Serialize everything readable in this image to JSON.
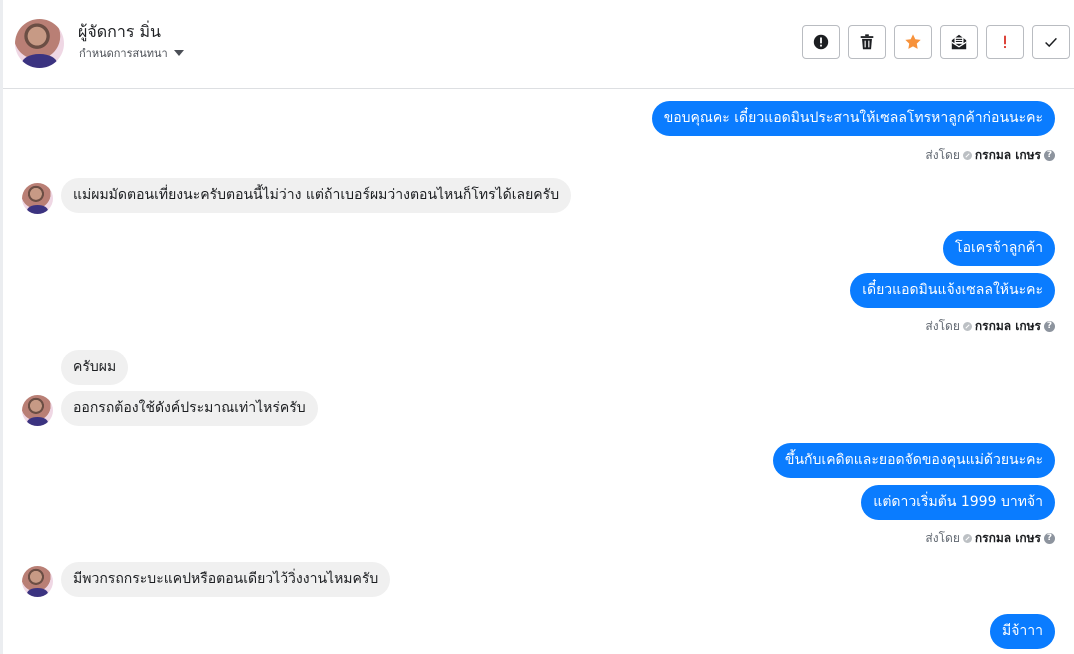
{
  "header": {
    "name": "ผู้จัดการ มิ่น",
    "subtitle": "กำหนดการสนทนา"
  },
  "toolbar": {
    "buttons": [
      {
        "icon": "alert-circle-icon"
      },
      {
        "icon": "trash-icon"
      },
      {
        "icon": "star-icon",
        "color": "#f7923b"
      },
      {
        "icon": "mail-open-icon"
      },
      {
        "icon": "exclamation-icon",
        "color": "#d93025"
      },
      {
        "icon": "check-icon"
      }
    ]
  },
  "meta": {
    "sent_by_label": "ส่งโดย",
    "sender": "กรกมล เกษร",
    "help": "?"
  },
  "messages": [
    {
      "dir": "out",
      "text": "ขอบคุณคะ เดี๋ยวแอดมินประสานให้เซลลโทรหาลูกค้าก่อนนะคะ"
    },
    {
      "dir": "in",
      "text": "แม่ผมมัดตอนเที่ยงนะครับตอนนี้ไม่ว่าง  แต่ถ้าเบอร์ผมว่างตอนไหนก็โทรได้เลยครับ"
    },
    {
      "dir": "out",
      "text": "โอเครจ้าลูกค้า"
    },
    {
      "dir": "out",
      "text": "เดี๋ยวแอดมินแจ้งเซลลให้นะคะ"
    },
    {
      "dir": "in",
      "text": "ครับผม"
    },
    {
      "dir": "in",
      "text": "ออกรถต้องใช้ดังค์ประมาณเท่าไหร่ครับ"
    },
    {
      "dir": "out",
      "text": "ขึ้นกับเคดิตและยอดจัดของคุนแม่ด้วยนะคะ"
    },
    {
      "dir": "out",
      "text": "แต่ดาวเริ่มต้น 1999 บาทจ้า"
    },
    {
      "dir": "in",
      "text": "มีพวกรถกระบะแคปหรือตอนเดียวไว้วิ่งงานไหมครับ"
    },
    {
      "dir": "out",
      "text": "มีจ้าาา"
    }
  ]
}
